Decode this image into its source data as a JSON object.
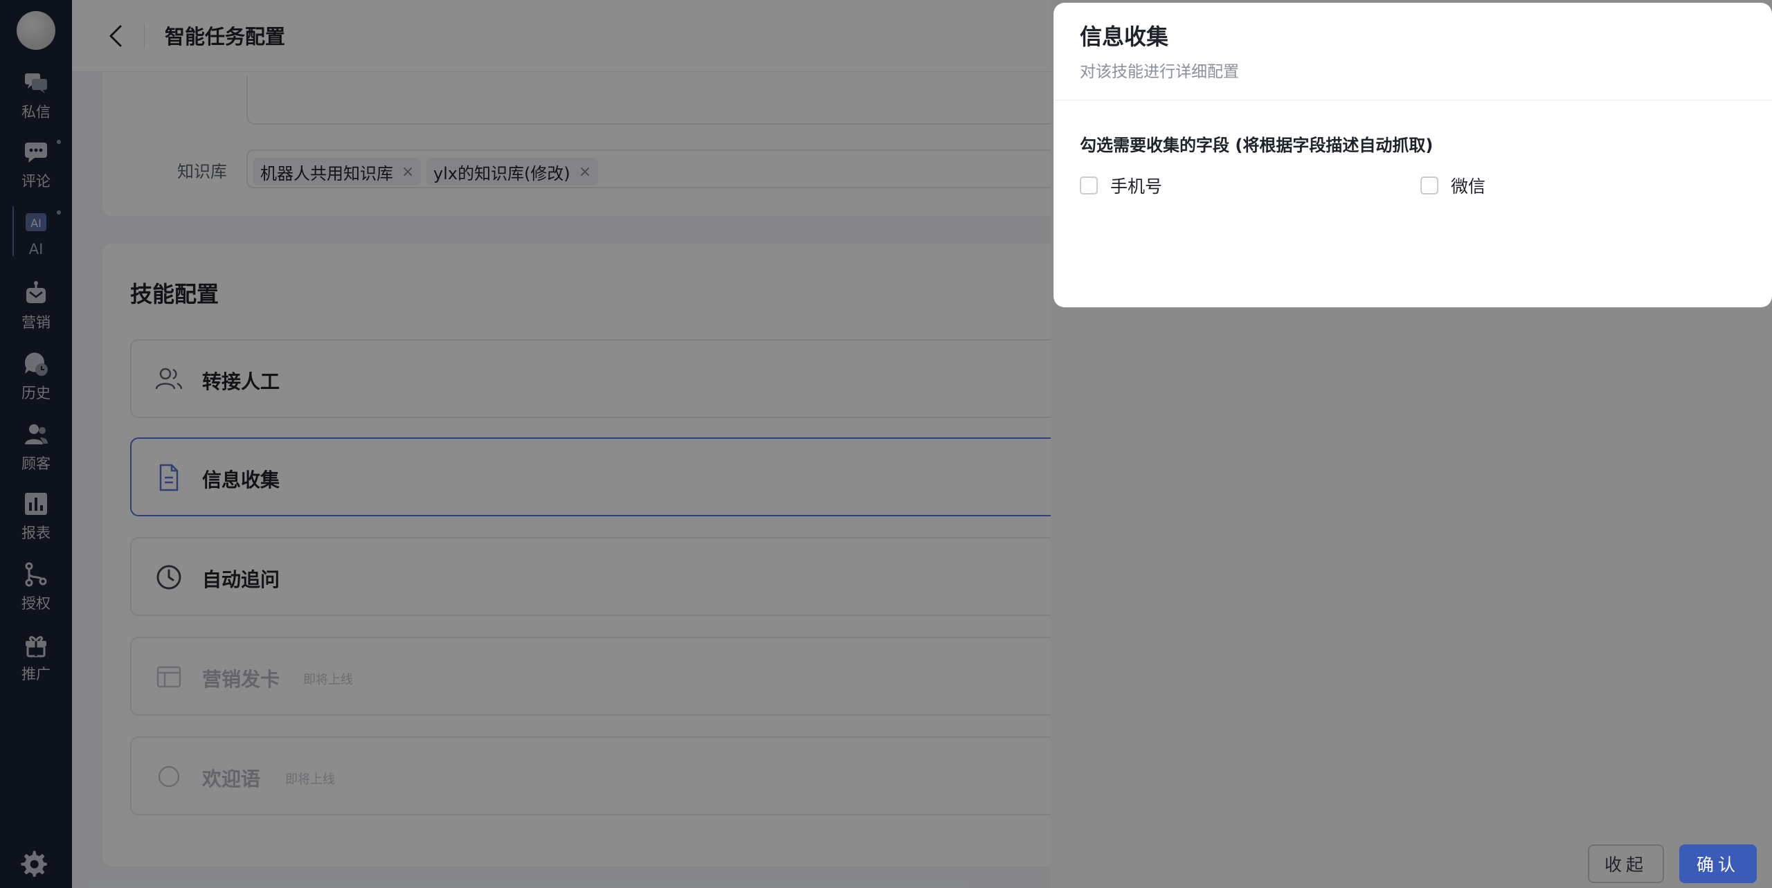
{
  "sidebar": {
    "items": [
      {
        "label": "私信",
        "icon": "chat-bubbles-icon"
      },
      {
        "label": "评论",
        "icon": "comment-icon"
      },
      {
        "label": "AI",
        "icon": "ai-icon"
      },
      {
        "label": "营销",
        "icon": "robot-mail-icon"
      },
      {
        "label": "历史",
        "icon": "history-icon"
      },
      {
        "label": "顾客",
        "icon": "customers-icon"
      },
      {
        "label": "报表",
        "icon": "bar-chart-icon"
      },
      {
        "label": "授权",
        "icon": "authorize-icon"
      },
      {
        "label": "推广",
        "icon": "gift-icon"
      }
    ]
  },
  "header": {
    "title": "智能任务配置"
  },
  "knowledge": {
    "label": "知识库",
    "tags": [
      "机器人共用知识库",
      "ylx的知识库(修改)"
    ],
    "remove_glyph": "×"
  },
  "skills": {
    "title": "技能配置",
    "items": [
      {
        "name": "转接人工",
        "icon": "users-icon",
        "status": ""
      },
      {
        "name": "信息收集",
        "icon": "document-icon",
        "status": ""
      },
      {
        "name": "自动追问",
        "icon": "clock-icon",
        "status": ""
      },
      {
        "name": "营销发卡",
        "icon": "card-icon",
        "status": "即将上线"
      },
      {
        "name": "欢迎语",
        "icon": "circle-icon",
        "status": "即将上线"
      }
    ]
  },
  "drawer": {
    "title": "信息收集",
    "subtitle": "对该技能进行详细配置",
    "question": "勾选需要收集的字段 (将根据字段描述自动抓取)",
    "fields": [
      {
        "label": "手机号",
        "checked": false
      },
      {
        "label": "微信",
        "checked": false
      }
    ],
    "collapse_label": "收起",
    "confirm_label": "确认"
  },
  "colors": {
    "sidebar_bg": "#1b2233",
    "accent": "#3a5cb8",
    "selected_border": "#5876d4"
  }
}
